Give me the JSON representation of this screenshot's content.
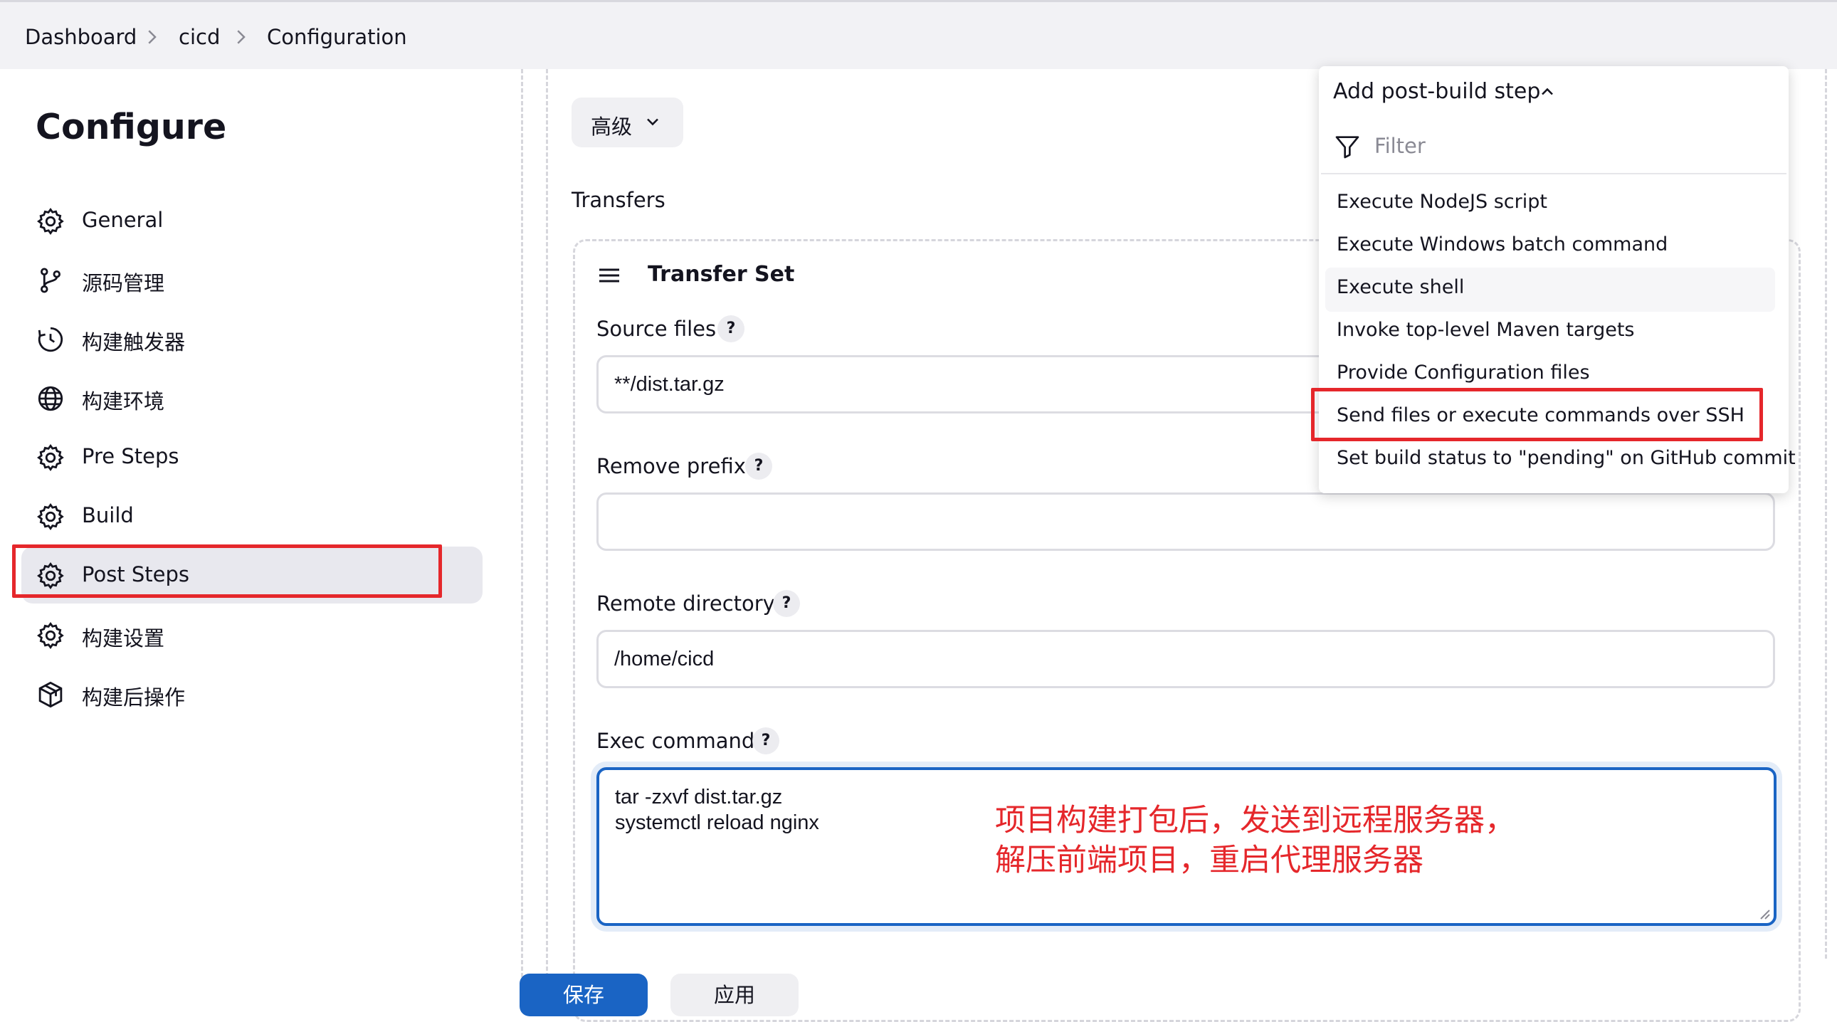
{
  "breadcrumb": {
    "items": [
      "Dashboard",
      "cicd",
      "Configuration"
    ]
  },
  "page": {
    "title": "Configure"
  },
  "sidebar": {
    "items": [
      {
        "label": "General",
        "icon": "gear-icon"
      },
      {
        "label": "源码管理",
        "icon": "git-branch-icon"
      },
      {
        "label": "构建触发器",
        "icon": "clock-icon"
      },
      {
        "label": "构建环境",
        "icon": "globe-icon"
      },
      {
        "label": "Pre Steps",
        "icon": "gear-icon"
      },
      {
        "label": "Build",
        "icon": "gear-icon"
      },
      {
        "label": "Post Steps",
        "icon": "gear-icon",
        "active": true
      },
      {
        "label": "构建设置",
        "icon": "gear-icon"
      },
      {
        "label": "构建后操作",
        "icon": "cube-icon"
      }
    ]
  },
  "main": {
    "advanced_label": "高级",
    "transfers_label": "Transfers",
    "transfer_set": {
      "title": "Transfer Set",
      "source_files_label": "Source files",
      "source_files_value": "**/dist.tar.gz",
      "remove_prefix_label": "Remove prefix",
      "remove_prefix_value": "",
      "remote_directory_label": "Remote directory",
      "remote_directory_value": "/home/cicd",
      "exec_command_label": "Exec command",
      "exec_command_lines": [
        "tar -zxvf dist.tar.gz",
        "systemctl reload nginx"
      ],
      "help": "?"
    },
    "annotation": {
      "line1": "项目构建打包后，发送到远程服务器，",
      "line2": "解压前端项目，重启代理服务器"
    }
  },
  "footer": {
    "save_label": "保存",
    "apply_label": "应用"
  },
  "dropdown": {
    "button_label": "Add post-build step",
    "filter_placeholder": "Filter",
    "items": [
      "Execute NodeJS script",
      "Execute Windows batch command",
      "Execute shell",
      "Invoke top-level Maven targets",
      "Provide Configuration files",
      "Send files or execute commands over SSH",
      "Set build status to \"pending\" on GitHub commit"
    ],
    "highlighted_item": "Send files or execute commands over SSH"
  },
  "colors": {
    "highlight_red": "#e5272b",
    "primary_blue": "#1a64c4",
    "active_nav_bg": "#e8e8ee"
  }
}
